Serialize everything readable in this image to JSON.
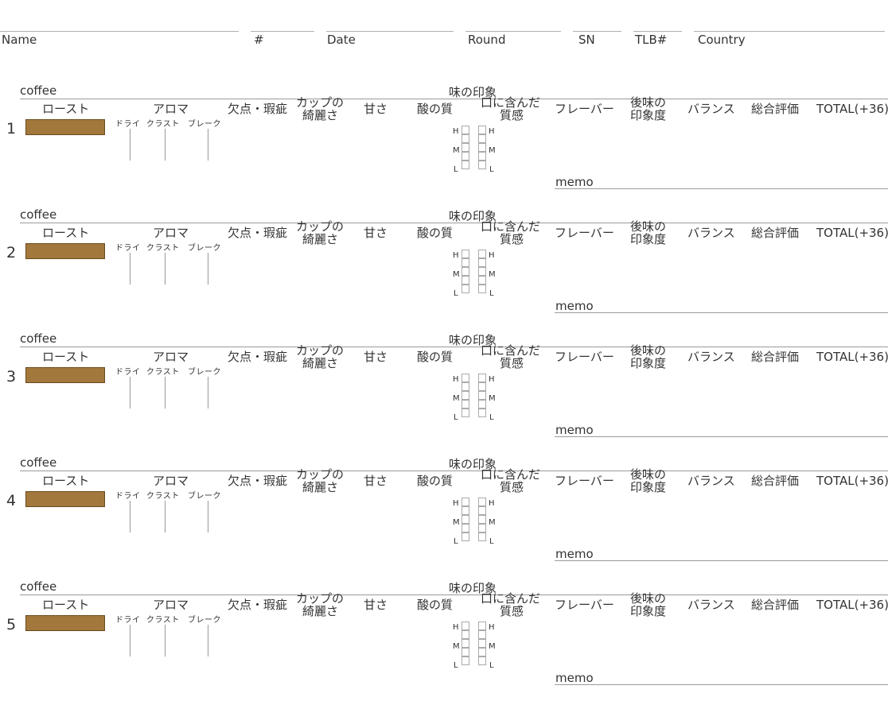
{
  "header": {
    "fields": [
      {
        "key": "name",
        "label": "Name"
      },
      {
        "key": "number",
        "label": "#"
      },
      {
        "key": "date",
        "label": "Date"
      },
      {
        "key": "round",
        "label": "Round"
      },
      {
        "key": "sn",
        "label": "SN"
      },
      {
        "key": "tlb",
        "label": "TLB#"
      },
      {
        "key": "country",
        "label": "Country"
      }
    ]
  },
  "labels": {
    "coffee": "coffee",
    "impression": "味の印象",
    "roast": "ロースト",
    "aroma": "アロマ",
    "aroma_dry": "ドライ",
    "aroma_crust": "クラスト",
    "aroma_break": "ブレーク",
    "defects": "欠点・瑕疵",
    "clean_cup_1": "カップの",
    "clean_cup_2": "綺麗さ",
    "sweetness": "甘さ",
    "acidity": "酸の質",
    "mouthfeel_1": "口に含んだ",
    "mouthfeel_2": "質感",
    "flavor": "フレーバー",
    "aftertaste_1": "後味の",
    "aftertaste_2": "印象度",
    "balance": "バランス",
    "overall": "総合評価",
    "total": "TOTAL(+36)",
    "memo": "memo",
    "scale_h": "H",
    "scale_m": "M",
    "scale_l": "L"
  },
  "samples": [
    {
      "number": "1"
    },
    {
      "number": "2"
    },
    {
      "number": "3"
    },
    {
      "number": "4"
    },
    {
      "number": "5"
    }
  ],
  "colors": {
    "roast_bar": "#a3783c"
  }
}
